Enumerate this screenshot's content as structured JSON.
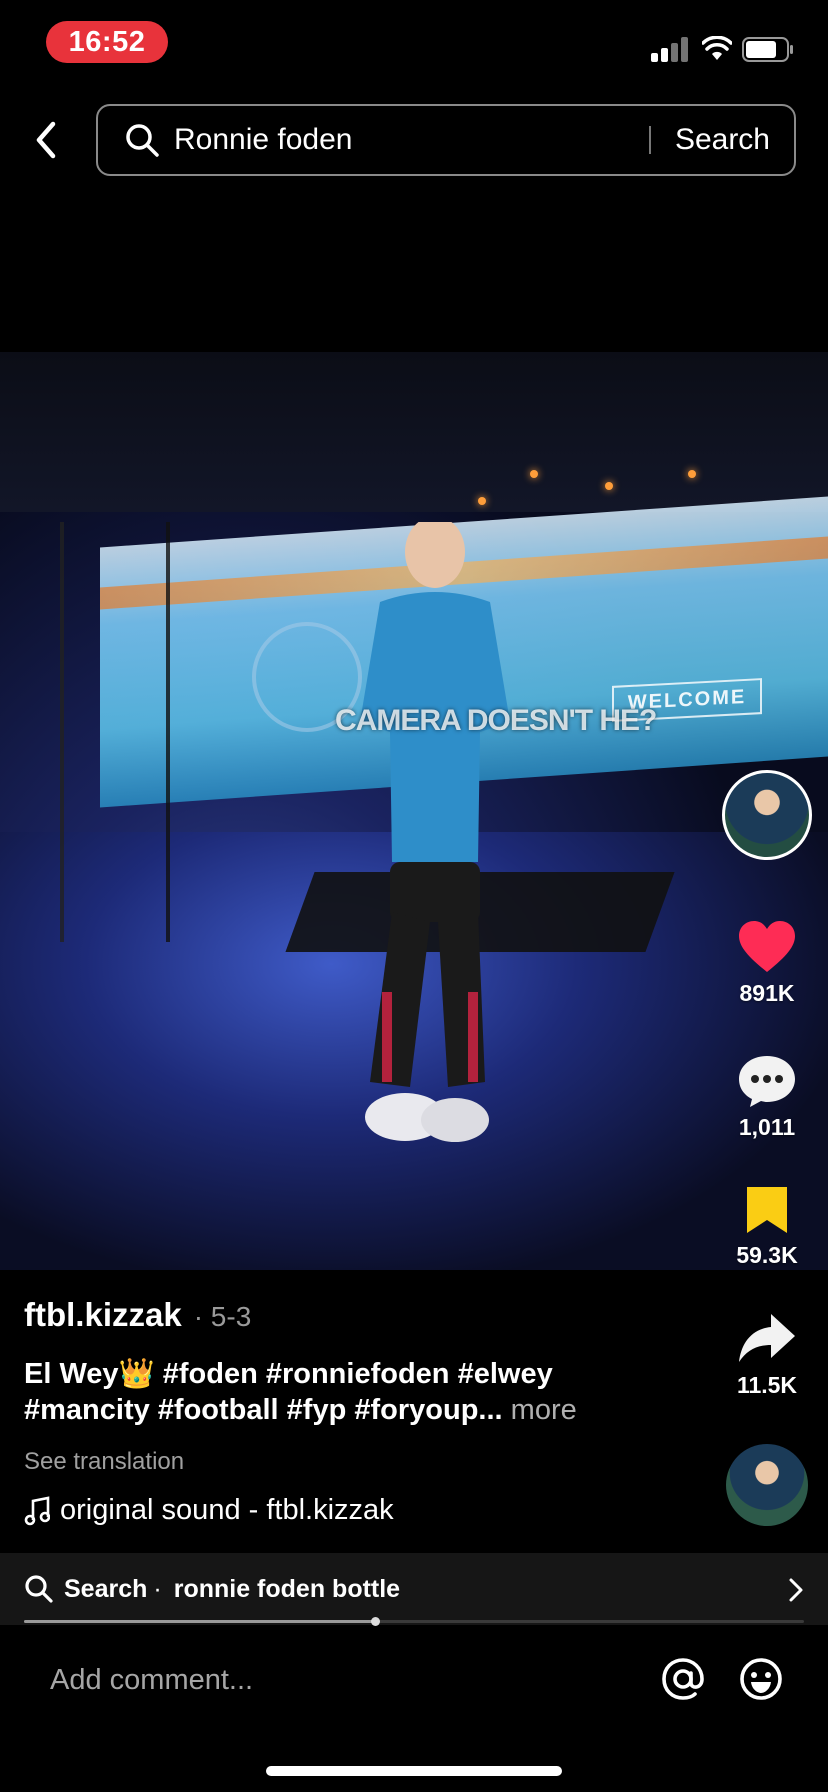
{
  "status_bar": {
    "time": "16:52",
    "time_pill_color": "#e8333b",
    "signal_icon": "signal-icon",
    "wifi_icon": "wifi-icon",
    "battery_icon": "battery-icon"
  },
  "header": {
    "back_icon": "back-chevron-icon",
    "search_icon": "search-icon",
    "query": "Ronnie foden",
    "search_button": "Search"
  },
  "video": {
    "overlay_caption": "CAMERA DOESN'T HE?",
    "wall_sign": "WELCOME"
  },
  "actions": {
    "likes": "891K",
    "comments": "1,011",
    "saves": "59.3K",
    "shares": "11.5K",
    "like_color": "#fe2c55",
    "save_color": "#facd14"
  },
  "post": {
    "username": "ftbl.kizzak",
    "date": "· 5-3",
    "description_line1": "El Wey👑 #foden #ronniefoden #elwey",
    "description_line2": "#mancity #football #fyp #foryoup...",
    "more_label": "more",
    "see_translation": "See translation",
    "sound": "original sound - ftbl.kizzak"
  },
  "suggestion": {
    "label": "Search",
    "separator": "·",
    "term": "ronnie foden bottle",
    "progress": 0.45
  },
  "comment": {
    "placeholder": "Add comment...",
    "mention_icon": "at-icon",
    "emoji_icon": "emoji-icon"
  }
}
